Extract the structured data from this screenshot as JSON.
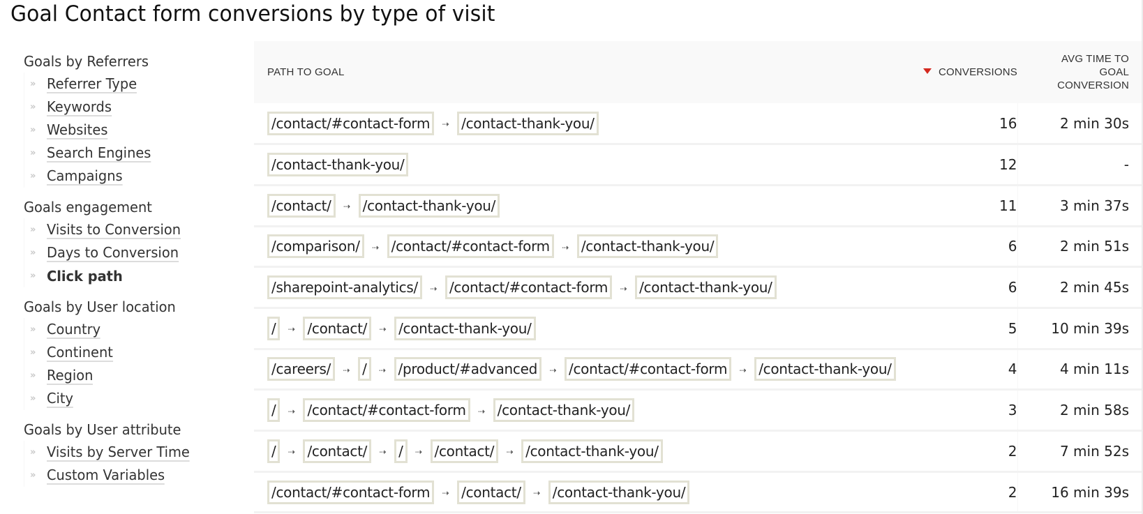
{
  "page": {
    "title": "Goal Contact form conversions by type of visit"
  },
  "sidebar": {
    "sections": [
      {
        "heading": "Goals by Referrers",
        "items": [
          {
            "label": "Referrer Type",
            "active": false
          },
          {
            "label": "Keywords",
            "active": false
          },
          {
            "label": "Websites",
            "active": false
          },
          {
            "label": "Search Engines",
            "active": false
          },
          {
            "label": "Campaigns",
            "active": false
          }
        ]
      },
      {
        "heading": "Goals engagement",
        "items": [
          {
            "label": "Visits to Conversion",
            "active": false
          },
          {
            "label": "Days to Conversion",
            "active": false
          },
          {
            "label": "Click path",
            "active": true
          }
        ]
      },
      {
        "heading": "Goals by User location",
        "items": [
          {
            "label": "Country",
            "active": false
          },
          {
            "label": "Continent",
            "active": false
          },
          {
            "label": "Region",
            "active": false
          },
          {
            "label": "City",
            "active": false
          }
        ]
      },
      {
        "heading": "Goals by User attribute",
        "items": [
          {
            "label": "Visits by Server Time",
            "active": false
          },
          {
            "label": "Custom Variables",
            "active": false
          }
        ]
      }
    ],
    "bullet_icon": "»"
  },
  "table": {
    "columns": {
      "path": "PATH TO GOAL",
      "conversions": "CONVERSIONS",
      "avg_time": "AVG TIME TO GOAL CONVERSION"
    },
    "sort": {
      "column": "conversions",
      "direction": "desc",
      "color": "#d4291f"
    },
    "arrow_icon": "⇢",
    "rows": [
      {
        "path": [
          "/contact/#contact-form",
          "/contact-thank-you/"
        ],
        "conversions": "16",
        "avg_time": "2 min 30s"
      },
      {
        "path": [
          "/contact-thank-you/"
        ],
        "conversions": "12",
        "avg_time": "-"
      },
      {
        "path": [
          "/contact/",
          "/contact-thank-you/"
        ],
        "conversions": "11",
        "avg_time": "3 min 37s"
      },
      {
        "path": [
          "/comparison/",
          "/contact/#contact-form",
          "/contact-thank-you/"
        ],
        "conversions": "6",
        "avg_time": "2 min 51s"
      },
      {
        "path": [
          "/sharepoint-analytics/",
          "/contact/#contact-form",
          "/contact-thank-you/"
        ],
        "conversions": "6",
        "avg_time": "2 min 45s"
      },
      {
        "path": [
          "/",
          "/contact/",
          "/contact-thank-you/"
        ],
        "conversions": "5",
        "avg_time": "10 min 39s"
      },
      {
        "path": [
          "/careers/",
          "/",
          "/product/#advanced",
          "/contact/#contact-form",
          "/contact-thank-you/"
        ],
        "conversions": "4",
        "avg_time": "4 min 11s"
      },
      {
        "path": [
          "/",
          "/contact/#contact-form",
          "/contact-thank-you/"
        ],
        "conversions": "3",
        "avg_time": "2 min 58s"
      },
      {
        "path": [
          "/",
          "/contact/",
          "/",
          "/contact/",
          "/contact-thank-you/"
        ],
        "conversions": "2",
        "avg_time": "7 min 52s"
      },
      {
        "path": [
          "/contact/#contact-form",
          "/contact/",
          "/contact-thank-you/"
        ],
        "conversions": "2",
        "avg_time": "16 min 39s"
      }
    ]
  },
  "colors": {
    "step_border": "#e2e1d3",
    "header_bg": "#f9f9f9",
    "row_divider": "#f2f2f2"
  }
}
